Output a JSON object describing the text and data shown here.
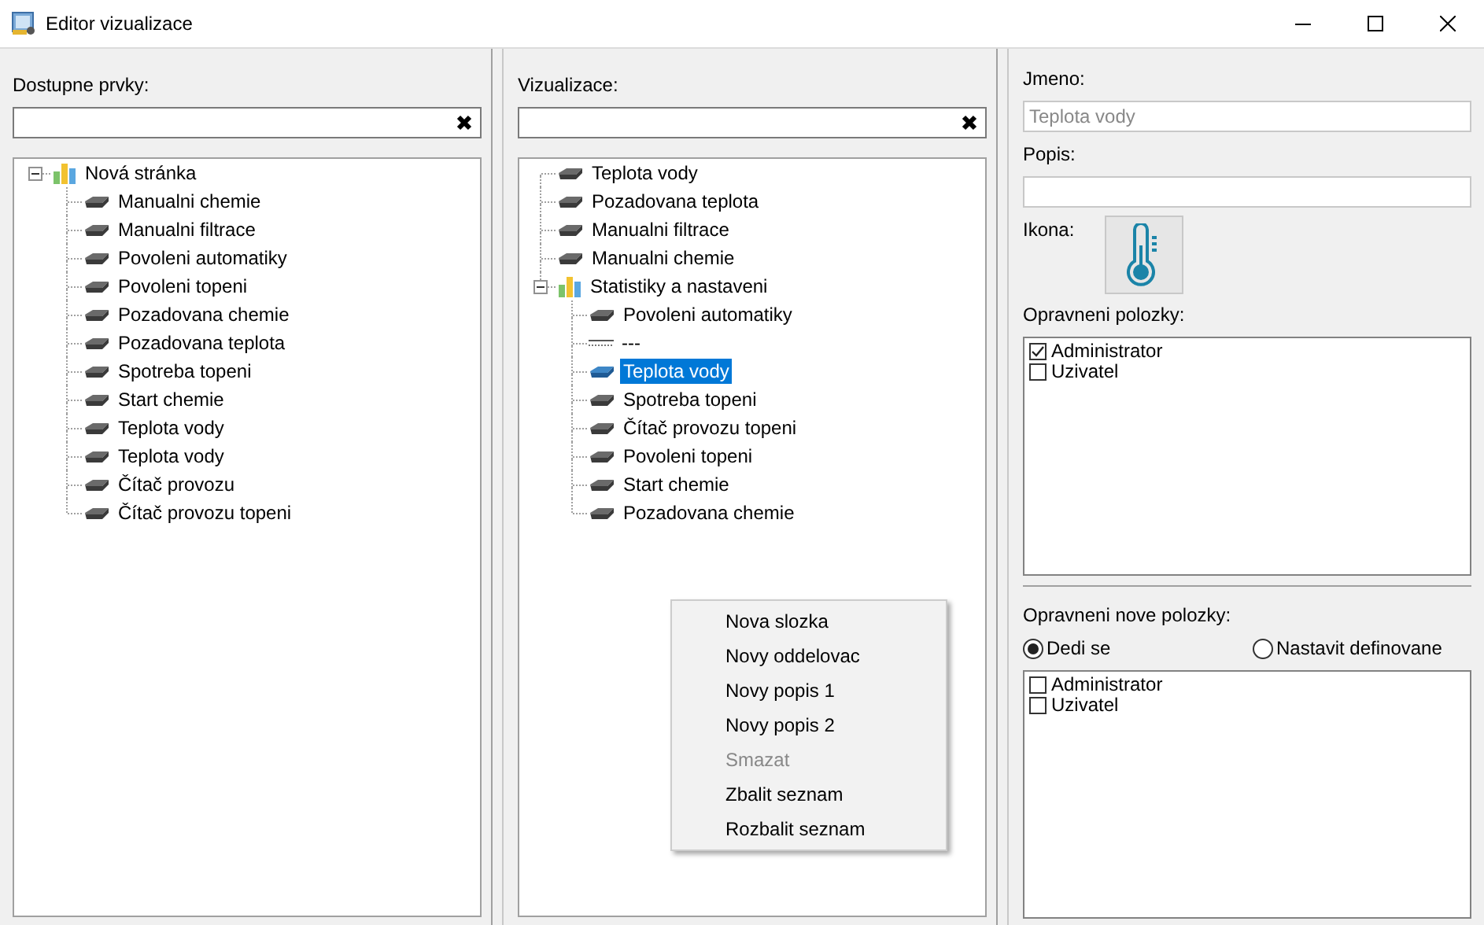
{
  "window": {
    "title": "Editor vizualizace"
  },
  "available": {
    "label": "Dostupne prvky:",
    "tree": [
      {
        "kind": "folder",
        "label": "Nová stránka",
        "expanded": true,
        "selected": false,
        "children": [
          {
            "kind": "item",
            "label": "Manualni chemie",
            "selected": false
          },
          {
            "kind": "item",
            "label": "Manualni filtrace",
            "selected": false
          },
          {
            "kind": "item",
            "label": "Povoleni automatiky",
            "selected": false
          },
          {
            "kind": "item",
            "label": "Povoleni topeni",
            "selected": false
          },
          {
            "kind": "item",
            "label": "Pozadovana chemie",
            "selected": false
          },
          {
            "kind": "item",
            "label": "Pozadovana teplota",
            "selected": false
          },
          {
            "kind": "item",
            "label": "Spotreba topeni",
            "selected": false
          },
          {
            "kind": "item",
            "label": "Start chemie",
            "selected": false
          },
          {
            "kind": "item",
            "label": "Teplota vody",
            "selected": false
          },
          {
            "kind": "item",
            "label": "Teplota vody",
            "selected": false
          },
          {
            "kind": "item",
            "label": "Čítač provozu",
            "selected": false
          },
          {
            "kind": "item",
            "label": "Čítač provozu topeni",
            "selected": false
          }
        ]
      }
    ]
  },
  "visualization": {
    "label": "Vizualizace:",
    "tree": [
      {
        "kind": "item",
        "label": "Teplota vody",
        "selected": false
      },
      {
        "kind": "item",
        "label": "Pozadovana teplota",
        "selected": false
      },
      {
        "kind": "item",
        "label": "Manualni filtrace",
        "selected": false
      },
      {
        "kind": "item",
        "label": "Manualni chemie",
        "selected": false
      },
      {
        "kind": "folder",
        "label": "Statistiky a nastaveni",
        "expanded": true,
        "selected": false,
        "children": [
          {
            "kind": "item",
            "label": "Povoleni automatiky",
            "selected": false
          },
          {
            "kind": "separator",
            "label": "---",
            "selected": false
          },
          {
            "kind": "item",
            "label": "Teplota vody",
            "selected": true
          },
          {
            "kind": "item",
            "label": "Spotreba topeni",
            "selected": false
          },
          {
            "kind": "item",
            "label": "Čítač provozu topeni",
            "selected": false
          },
          {
            "kind": "item",
            "label": "Povoleni topeni",
            "selected": false
          },
          {
            "kind": "item",
            "label": "Start chemie",
            "selected": false
          },
          {
            "kind": "item",
            "label": "Pozadovana chemie",
            "selected": false
          }
        ]
      }
    ]
  },
  "properties": {
    "name_label": "Jmeno:",
    "name_placeholder": "Teplota vody",
    "description_label": "Popis:",
    "icon_label": "Ikona:",
    "permissions_label": "Opravneni polozky:",
    "permissions": [
      {
        "label": "Administrator",
        "checked": true
      },
      {
        "label": "Uzivatel",
        "checked": false
      }
    ],
    "new_permissions_label": "Opravneni nove polozky:",
    "modes": [
      {
        "label": "Dedi se",
        "selected": true
      },
      {
        "label": "Nastavit definovane",
        "selected": false
      }
    ],
    "new_permissions": [
      {
        "label": "Administrator",
        "checked": false
      },
      {
        "label": "Uzivatel",
        "checked": false
      }
    ]
  },
  "context_menu": {
    "items": [
      {
        "label": "Nova slozka",
        "disabled": false
      },
      {
        "label": "Novy oddelovac",
        "disabled": false
      },
      {
        "label": "Novy popis 1",
        "disabled": false
      },
      {
        "label": "Novy popis 2",
        "disabled": false
      },
      {
        "label": "Smazat",
        "disabled": true
      },
      {
        "label": "Zbalit seznam",
        "disabled": false
      },
      {
        "label": "Rozbalit seznam",
        "disabled": false
      }
    ]
  }
}
